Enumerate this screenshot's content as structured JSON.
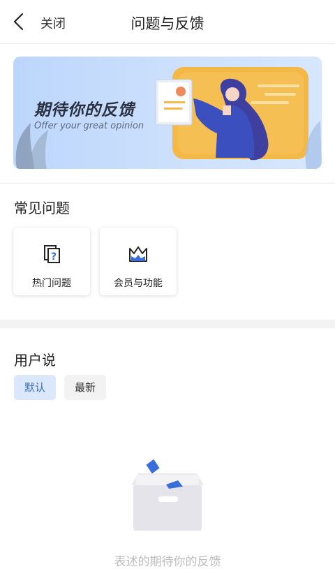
{
  "header": {
    "close_label": "关闭",
    "title": "问题与反馈"
  },
  "banner": {
    "title": "期待你的反馈",
    "subtitle": "Offer your great opinion"
  },
  "faq": {
    "section_title": "常见问题",
    "cards": [
      {
        "label": "热门问题",
        "icon": "question-doc-icon"
      },
      {
        "label": "会员与功能",
        "icon": "crown-icon"
      }
    ]
  },
  "user_says": {
    "section_title": "用户说",
    "tabs": [
      {
        "label": "默认",
        "active": true
      },
      {
        "label": "最新",
        "active": false
      }
    ]
  },
  "empty_state": {
    "icon": "empty-box-icon",
    "text": "表述的期待你的反馈"
  },
  "colors": {
    "accent": "#3a6fb5",
    "active_tab_bg": "#dbe8fb"
  }
}
